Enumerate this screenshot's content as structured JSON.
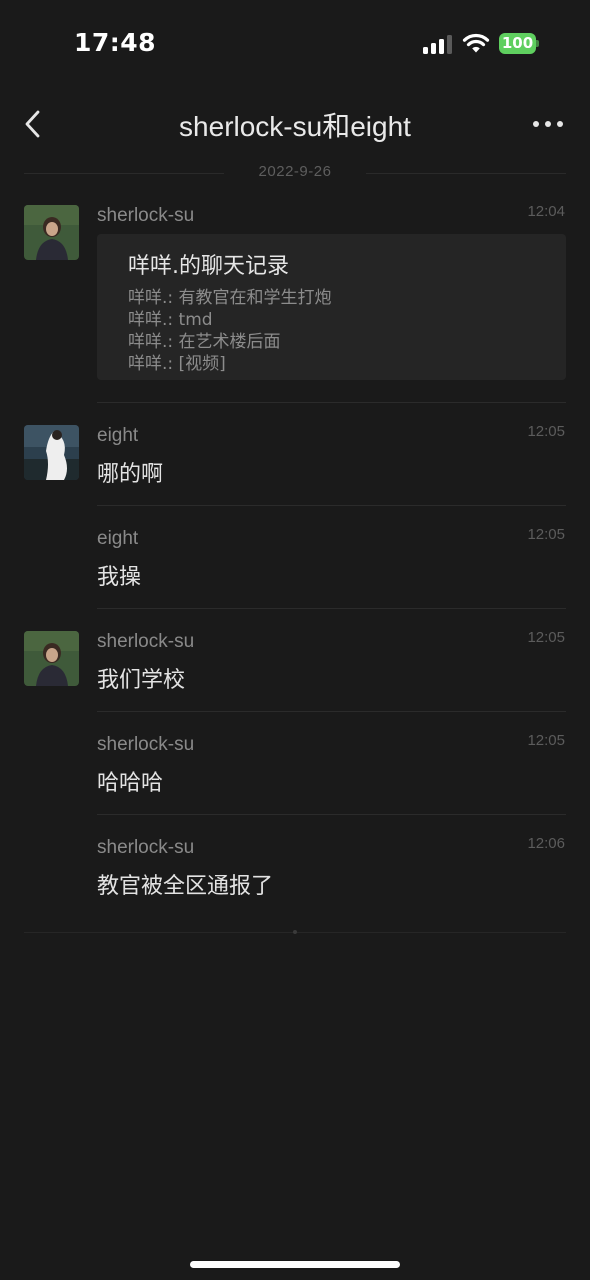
{
  "status_bar": {
    "time": "17:48",
    "battery": "100",
    "icons": [
      "signal-icon",
      "wifi-icon",
      "battery-icon"
    ]
  },
  "nav": {
    "title": "sherlock-su和eight",
    "icons": [
      "chevron-left-icon",
      "more-icon"
    ]
  },
  "date_separator": "2022-9-26",
  "forwarded_card": {
    "sender": "sherlock-su",
    "time": "12:04",
    "title": "咩咩.的聊天记录",
    "lines": [
      "咩咩.: 有教官在和学生打炮",
      "咩咩.: tmd",
      "咩咩.: 在艺术楼后面",
      "咩咩.: [视频]"
    ]
  },
  "messages": [
    {
      "sender": "eight",
      "time": "12:05",
      "text": "哪的啊"
    },
    {
      "sender": "eight",
      "time": "12:05",
      "text": "我操"
    },
    {
      "sender": "sherlock-su",
      "time": "12:05",
      "text": "我们学校"
    },
    {
      "sender": "sherlock-su",
      "time": "12:05",
      "text": "哈哈哈"
    },
    {
      "sender": "sherlock-su",
      "time": "12:06",
      "text": "教官被全区通报了"
    }
  ],
  "colors": {
    "background": "#1a1a1a",
    "card": "#252525",
    "battery": "#5fcf5f"
  }
}
